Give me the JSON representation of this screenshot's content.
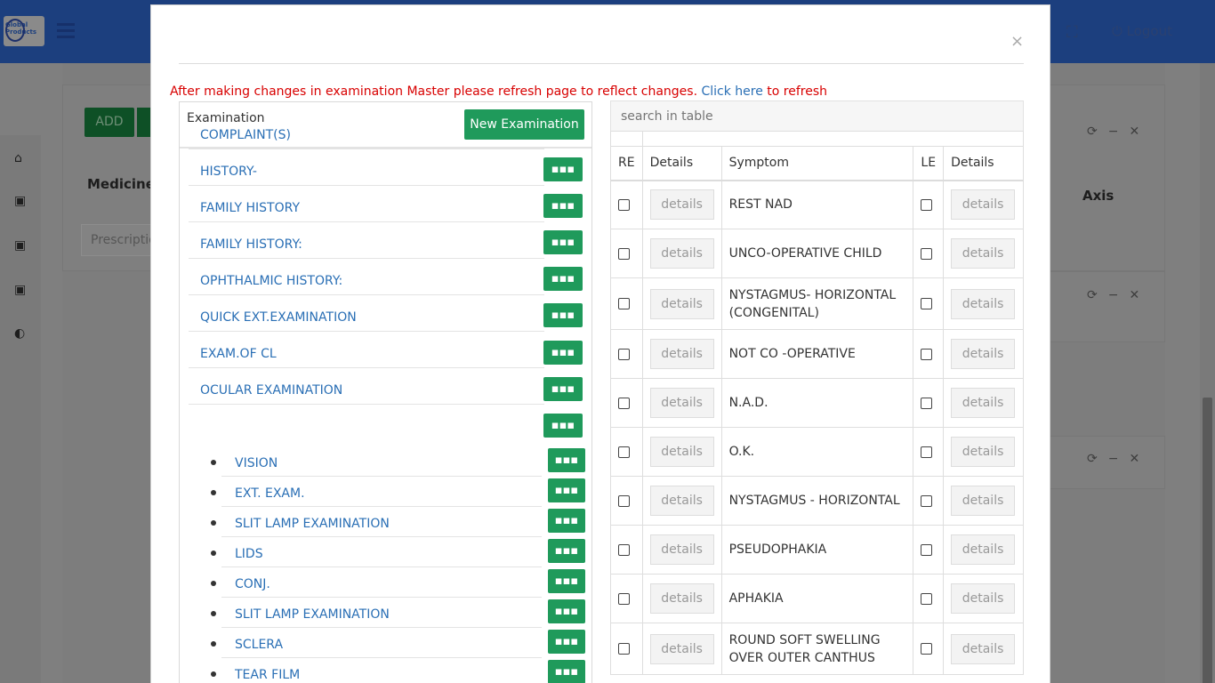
{
  "background": {
    "logo_text": "Global Products",
    "logout_label": "Logout",
    "add_label": "ADD",
    "medicine_label": "Medicine",
    "prescription_placeholder": "Prescriptio",
    "axis_label": "Axis"
  },
  "modal": {
    "close_label": "×",
    "warning_text": "After making changes in examination Master please refresh page to reflect changes. ",
    "refresh_link": "Click here",
    "refresh_suffix": " to refresh"
  },
  "examination": {
    "title": "Examination",
    "new_button": "New Examination",
    "dots_label": "▪▪▪",
    "items": [
      {
        "label": "COMPLAINT(S)"
      },
      {
        "label": "HISTORY-"
      },
      {
        "label": "FAMILY HISTORY"
      },
      {
        "label": "FAMILY HISTORY:"
      },
      {
        "label": "OPHTHALMIC HISTORY:"
      },
      {
        "label": "QUICK EXT.EXAMINATION"
      },
      {
        "label": "EXAM.OF CL"
      },
      {
        "label": "OCULAR EXAMINATION"
      }
    ],
    "sub_items": [
      {
        "label": "VISION"
      },
      {
        "label": "EXT. EXAM."
      },
      {
        "label": "SLIT LAMP EXAMINATION"
      },
      {
        "label": "LIDS"
      },
      {
        "label": "CONJ."
      },
      {
        "label": "SLIT LAMP EXAMINATION"
      },
      {
        "label": "SCLERA"
      },
      {
        "label": "TEAR FILM"
      }
    ]
  },
  "symptoms": {
    "search_placeholder": "search in table",
    "headers": {
      "re": "RE",
      "details": "Details",
      "symptom": "Symptom",
      "le": "LE",
      "details2": "Details"
    },
    "details_label": "details",
    "rows": [
      {
        "symptom": "REST NAD"
      },
      {
        "symptom": "UNCO-OPERATIVE CHILD"
      },
      {
        "symptom": "NYSTAGMUS- HORIZONTAL (CONGENITAL)"
      },
      {
        "symptom": "NOT CO -OPERATIVE"
      },
      {
        "symptom": "N.A.D."
      },
      {
        "symptom": "O.K."
      },
      {
        "symptom": "NYSTAGMUS - HORIZONTAL"
      },
      {
        "symptom": "PSEUDOPHAKIA"
      },
      {
        "symptom": "APHAKIA"
      },
      {
        "symptom": "ROUND SOFT SWELLING OVER OUTER CANTHUS"
      }
    ]
  }
}
